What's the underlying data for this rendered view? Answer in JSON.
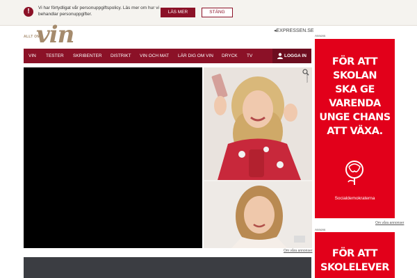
{
  "banner": {
    "text": "Vi har förtydligat vår personuppgiftspolicy. Läs mer om hur vi behandlar personuppgifter.",
    "more_label": "LÄS MER",
    "close_label": "STÄNG",
    "icon": "exclamation-icon",
    "accent": "#8b1127"
  },
  "header": {
    "logo_small": "ALLT OM",
    "logo_big": "vin",
    "expressen_link": "EXPRESSEN.SE"
  },
  "nav": {
    "items": [
      "VIN",
      "TESTER",
      "SKRIBENTER",
      "DISTRIKT",
      "VIN OCH MAT",
      "LÄR DIG OM VIN",
      "DRYCK",
      "TV"
    ],
    "login_label": "LOGGA IN",
    "background": "#8b1127"
  },
  "ads": {
    "side_label": "Annons",
    "left_footer": "Om våra annonser",
    "right_label_top": "Annons",
    "right_label_bottom": "Annons",
    "right_footer": "Om våra annonser",
    "campaign1_lines": [
      "FÖR ATT",
      "SKOLAN",
      "SKA GE",
      "VARENDA",
      "UNGE CHANS",
      "ATT VÄXA."
    ],
    "campaign1_brand": "Socialdemokraterna",
    "campaign2_lines": [
      "FÖR ATT",
      "SKOLELEVER"
    ],
    "campaign_color": "#e2001a"
  }
}
